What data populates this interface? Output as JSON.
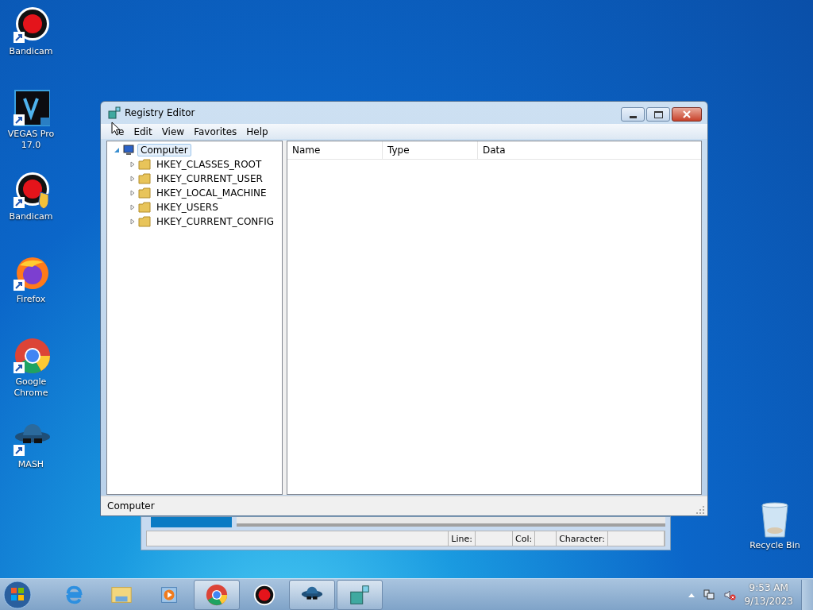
{
  "desktop_icons": [
    {
      "label": "Bandicam",
      "kind": "bandicam"
    },
    {
      "label": "VEGAS Pro 17.0",
      "kind": "vegas"
    },
    {
      "label": "Bandicam",
      "kind": "bandicam-admin"
    },
    {
      "label": "Firefox",
      "kind": "firefox"
    },
    {
      "label": "Google Chrome",
      "kind": "chrome"
    },
    {
      "label": "MASH",
      "kind": "mash"
    }
  ],
  "recycle_bin": {
    "label": "Recycle Bin"
  },
  "back_window": {
    "status_fields": [
      {
        "label": "Line:"
      },
      {
        "label": "Col:"
      },
      {
        "label": "Character:"
      }
    ]
  },
  "window": {
    "title": "Registry Editor",
    "menu": [
      "e",
      "Edit",
      "View",
      "Favorites",
      "Help"
    ],
    "tree": {
      "label": "Computer",
      "expanded": true,
      "selected": true,
      "children": [
        {
          "label": "HKEY_CLASSES_ROOT",
          "expanded": false
        },
        {
          "label": "HKEY_CURRENT_USER",
          "expanded": false
        },
        {
          "label": "HKEY_LOCAL_MACHINE",
          "expanded": false
        },
        {
          "label": "HKEY_USERS",
          "expanded": false
        },
        {
          "label": "HKEY_CURRENT_CONFIG",
          "expanded": false
        }
      ]
    },
    "columns": [
      "Name",
      "Type",
      "Data"
    ],
    "status_bar": "Computer"
  },
  "taskbar": {
    "items": [
      {
        "kind": "ie",
        "open": false
      },
      {
        "kind": "explorer",
        "open": false
      },
      {
        "kind": "media",
        "open": false
      },
      {
        "kind": "chrome",
        "open": true
      },
      {
        "kind": "bandicam",
        "open": false
      },
      {
        "kind": "mash",
        "open": true
      },
      {
        "kind": "regedit",
        "open": true
      }
    ],
    "time": "9:53 AM",
    "date": "9/13/2023"
  }
}
